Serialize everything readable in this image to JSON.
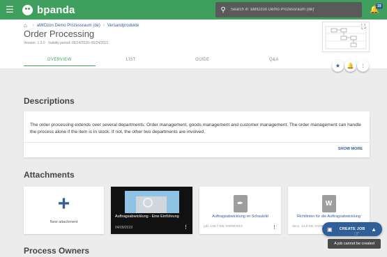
{
  "app": {
    "name": "bpanda"
  },
  "search": {
    "placeholder": "Search in 'aMIDzon Demo Prozessraum (de)'"
  },
  "notifications": {
    "count": "19"
  },
  "breadcrumb": {
    "space": "aMIDzon Demo Prozessraum (de)",
    "folder": "Versandprodukte"
  },
  "process": {
    "title": "Order Processing",
    "meta": "Version: 1.3.0 · Validity period: 05/24/2020–05/24/2021"
  },
  "tabs": [
    {
      "label": "OVERVIEW",
      "active": true
    },
    {
      "label": "LIST",
      "active": false
    },
    {
      "label": "GUIDE",
      "active": false
    },
    {
      "label": "Q&A",
      "active": false
    }
  ],
  "descriptions": {
    "heading": "Descriptions",
    "text": "The order processing extends over several departments: Order management, goods management and customer management. The order management can handle the process alone if the item is in stock. If not, the other two departments are involved.",
    "show_more": "SHOW MORE"
  },
  "attachments": {
    "heading": "Attachments",
    "new_label": "New attachment",
    "items": [
      {
        "title": "Auftragsabwicklung - Eine Einführung",
        "date": "04/09/2019",
        "icon": "video-thumbnail"
      },
      {
        "title": "Auftragsabwicklung im Schaubild",
        "meta": "pdf, 136.7 KB, 04/09/2019",
        "icon": "pdf-icon"
      },
      {
        "title": "Richtlinien für die Auftragsabwicklung",
        "meta": "docx, 14.8 KB, 04/09/2019",
        "icon": "word-icon"
      }
    ]
  },
  "owners": {
    "heading": "Process Owners"
  },
  "create_job": {
    "label": "CREATE JOB",
    "tooltip": "A job cannot be created"
  },
  "colors": {
    "topbar": "#3f9f5d",
    "accent": "#2f5f99",
    "active_tab": "#3f9f5d"
  }
}
